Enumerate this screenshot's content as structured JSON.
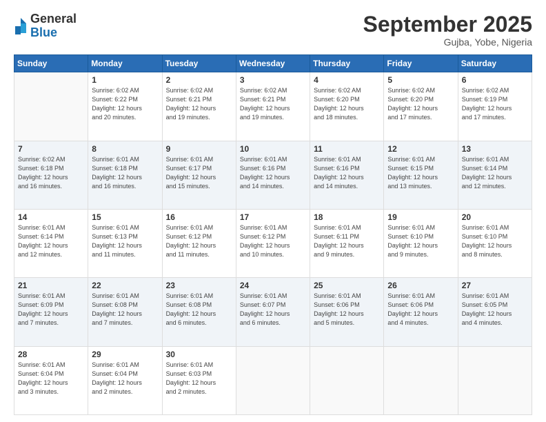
{
  "logo": {
    "line1": "General",
    "line2": "Blue"
  },
  "header": {
    "title": "September 2025",
    "location": "Gujba, Yobe, Nigeria"
  },
  "weekdays": [
    "Sunday",
    "Monday",
    "Tuesday",
    "Wednesday",
    "Thursday",
    "Friday",
    "Saturday"
  ],
  "weeks": [
    [
      {
        "day": "",
        "info": ""
      },
      {
        "day": "1",
        "info": "Sunrise: 6:02 AM\nSunset: 6:22 PM\nDaylight: 12 hours\nand 20 minutes."
      },
      {
        "day": "2",
        "info": "Sunrise: 6:02 AM\nSunset: 6:21 PM\nDaylight: 12 hours\nand 19 minutes."
      },
      {
        "day": "3",
        "info": "Sunrise: 6:02 AM\nSunset: 6:21 PM\nDaylight: 12 hours\nand 19 minutes."
      },
      {
        "day": "4",
        "info": "Sunrise: 6:02 AM\nSunset: 6:20 PM\nDaylight: 12 hours\nand 18 minutes."
      },
      {
        "day": "5",
        "info": "Sunrise: 6:02 AM\nSunset: 6:20 PM\nDaylight: 12 hours\nand 17 minutes."
      },
      {
        "day": "6",
        "info": "Sunrise: 6:02 AM\nSunset: 6:19 PM\nDaylight: 12 hours\nand 17 minutes."
      }
    ],
    [
      {
        "day": "7",
        "info": "Sunrise: 6:02 AM\nSunset: 6:18 PM\nDaylight: 12 hours\nand 16 minutes."
      },
      {
        "day": "8",
        "info": "Sunrise: 6:01 AM\nSunset: 6:18 PM\nDaylight: 12 hours\nand 16 minutes."
      },
      {
        "day": "9",
        "info": "Sunrise: 6:01 AM\nSunset: 6:17 PM\nDaylight: 12 hours\nand 15 minutes."
      },
      {
        "day": "10",
        "info": "Sunrise: 6:01 AM\nSunset: 6:16 PM\nDaylight: 12 hours\nand 14 minutes."
      },
      {
        "day": "11",
        "info": "Sunrise: 6:01 AM\nSunset: 6:16 PM\nDaylight: 12 hours\nand 14 minutes."
      },
      {
        "day": "12",
        "info": "Sunrise: 6:01 AM\nSunset: 6:15 PM\nDaylight: 12 hours\nand 13 minutes."
      },
      {
        "day": "13",
        "info": "Sunrise: 6:01 AM\nSunset: 6:14 PM\nDaylight: 12 hours\nand 12 minutes."
      }
    ],
    [
      {
        "day": "14",
        "info": "Sunrise: 6:01 AM\nSunset: 6:14 PM\nDaylight: 12 hours\nand 12 minutes."
      },
      {
        "day": "15",
        "info": "Sunrise: 6:01 AM\nSunset: 6:13 PM\nDaylight: 12 hours\nand 11 minutes."
      },
      {
        "day": "16",
        "info": "Sunrise: 6:01 AM\nSunset: 6:12 PM\nDaylight: 12 hours\nand 11 minutes."
      },
      {
        "day": "17",
        "info": "Sunrise: 6:01 AM\nSunset: 6:12 PM\nDaylight: 12 hours\nand 10 minutes."
      },
      {
        "day": "18",
        "info": "Sunrise: 6:01 AM\nSunset: 6:11 PM\nDaylight: 12 hours\nand 9 minutes."
      },
      {
        "day": "19",
        "info": "Sunrise: 6:01 AM\nSunset: 6:10 PM\nDaylight: 12 hours\nand 9 minutes."
      },
      {
        "day": "20",
        "info": "Sunrise: 6:01 AM\nSunset: 6:10 PM\nDaylight: 12 hours\nand 8 minutes."
      }
    ],
    [
      {
        "day": "21",
        "info": "Sunrise: 6:01 AM\nSunset: 6:09 PM\nDaylight: 12 hours\nand 7 minutes."
      },
      {
        "day": "22",
        "info": "Sunrise: 6:01 AM\nSunset: 6:08 PM\nDaylight: 12 hours\nand 7 minutes."
      },
      {
        "day": "23",
        "info": "Sunrise: 6:01 AM\nSunset: 6:08 PM\nDaylight: 12 hours\nand 6 minutes."
      },
      {
        "day": "24",
        "info": "Sunrise: 6:01 AM\nSunset: 6:07 PM\nDaylight: 12 hours\nand 6 minutes."
      },
      {
        "day": "25",
        "info": "Sunrise: 6:01 AM\nSunset: 6:06 PM\nDaylight: 12 hours\nand 5 minutes."
      },
      {
        "day": "26",
        "info": "Sunrise: 6:01 AM\nSunset: 6:06 PM\nDaylight: 12 hours\nand 4 minutes."
      },
      {
        "day": "27",
        "info": "Sunrise: 6:01 AM\nSunset: 6:05 PM\nDaylight: 12 hours\nand 4 minutes."
      }
    ],
    [
      {
        "day": "28",
        "info": "Sunrise: 6:01 AM\nSunset: 6:04 PM\nDaylight: 12 hours\nand 3 minutes."
      },
      {
        "day": "29",
        "info": "Sunrise: 6:01 AM\nSunset: 6:04 PM\nDaylight: 12 hours\nand 2 minutes."
      },
      {
        "day": "30",
        "info": "Sunrise: 6:01 AM\nSunset: 6:03 PM\nDaylight: 12 hours\nand 2 minutes."
      },
      {
        "day": "",
        "info": ""
      },
      {
        "day": "",
        "info": ""
      },
      {
        "day": "",
        "info": ""
      },
      {
        "day": "",
        "info": ""
      }
    ]
  ]
}
